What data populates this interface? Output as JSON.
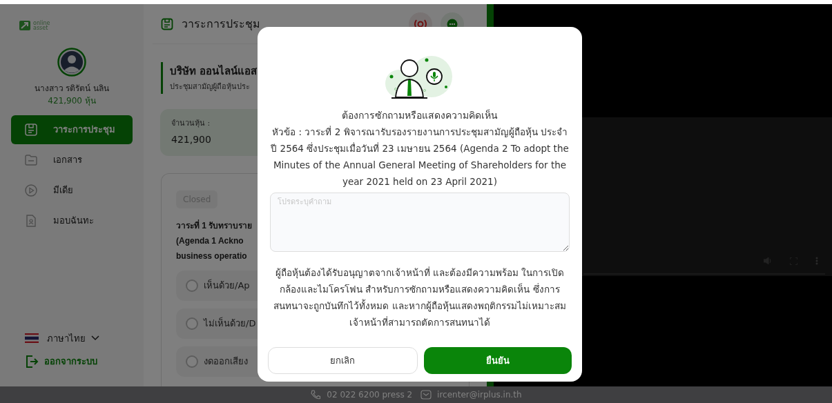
{
  "logo": {
    "line_1": "online",
    "line_2": "asset"
  },
  "user": {
    "name": "นางสาว รติรัตน์ นลิน",
    "shares": "421,900 หุ้น"
  },
  "sidebar": {
    "items": [
      {
        "label": "วาระการประชุม",
        "kind": "agenda",
        "selected": true
      },
      {
        "label": "เอกสาร",
        "kind": "folder",
        "selected": false
      },
      {
        "label": "มีเดีย",
        "kind": "media",
        "selected": false
      },
      {
        "label": "มอบฉันทะ",
        "kind": "proxy",
        "selected": false
      }
    ]
  },
  "language": {
    "label": "ภาษาไทย"
  },
  "logout": {
    "label": "ออกจากระบบ"
  },
  "header": {
    "title": "วาระการประชุม"
  },
  "company": {
    "name": "บริษัท ออนไลน์แอส",
    "meeting": "ประชุมสามัญผู้ถือหุ้นประ"
  },
  "share_card": {
    "label": "จำนวนหุ้น :",
    "value": "421,900"
  },
  "agenda_card": {
    "status": "Closed",
    "title_lines": [
      "วาระที่ 1 รับทราบราย",
      "(Agenda 1 Ackno",
      "business operatio"
    ],
    "options": [
      {
        "label": "เห็นด้วย/Ap",
        "selected": false
      },
      {
        "label": "ไม่เห็นด้วย/D",
        "selected": false
      },
      {
        "label": "งดออกเสียง",
        "selected": false
      }
    ]
  },
  "modal": {
    "title": "ต้องการซักถามหรือแสดงความคิดเห็น",
    "topic": "หัวข้อ : วาระที่ 2 พิจารณารับรองรายงานการประชุมสามัญผู้ถือหุ้น ประจำปี 2564 ซึ่งประชุมเมื่อวันที่ 23 เมษายน 2564 (Agenda 2 To adopt the Minutes of the Annual General Meeting of Shareholders for the year 2021 held on 23 April 2021)",
    "question_field": {
      "placeholder": "โปรดระบุคำถาม"
    },
    "notice": "ผู้ถือหุ้นต้องได้รับอนุญาตจากเจ้าหน้าที่ และต้องมีความพร้อม ในการเปิดกล้องและไมโครโฟน สำหรับการซักถามหรือแสดงความคิดเห็น ซึ่งการสนทนาจะถูกบันทึกไว้ทั้งหมด และหากผู้ถือหุ้นแสดงพฤติกรรมไม่เหมาะสม เจ้าหน้าที่สามารถตัดการสนทนาได้",
    "buttons": [
      {
        "label": "ยกเลิก",
        "kind": "cancel"
      },
      {
        "label": "ยืนยัน",
        "kind": "confirm"
      }
    ]
  },
  "footer": {
    "phone": "02 022 6200 press 2",
    "email": "ircenter@irplus.in.th"
  }
}
